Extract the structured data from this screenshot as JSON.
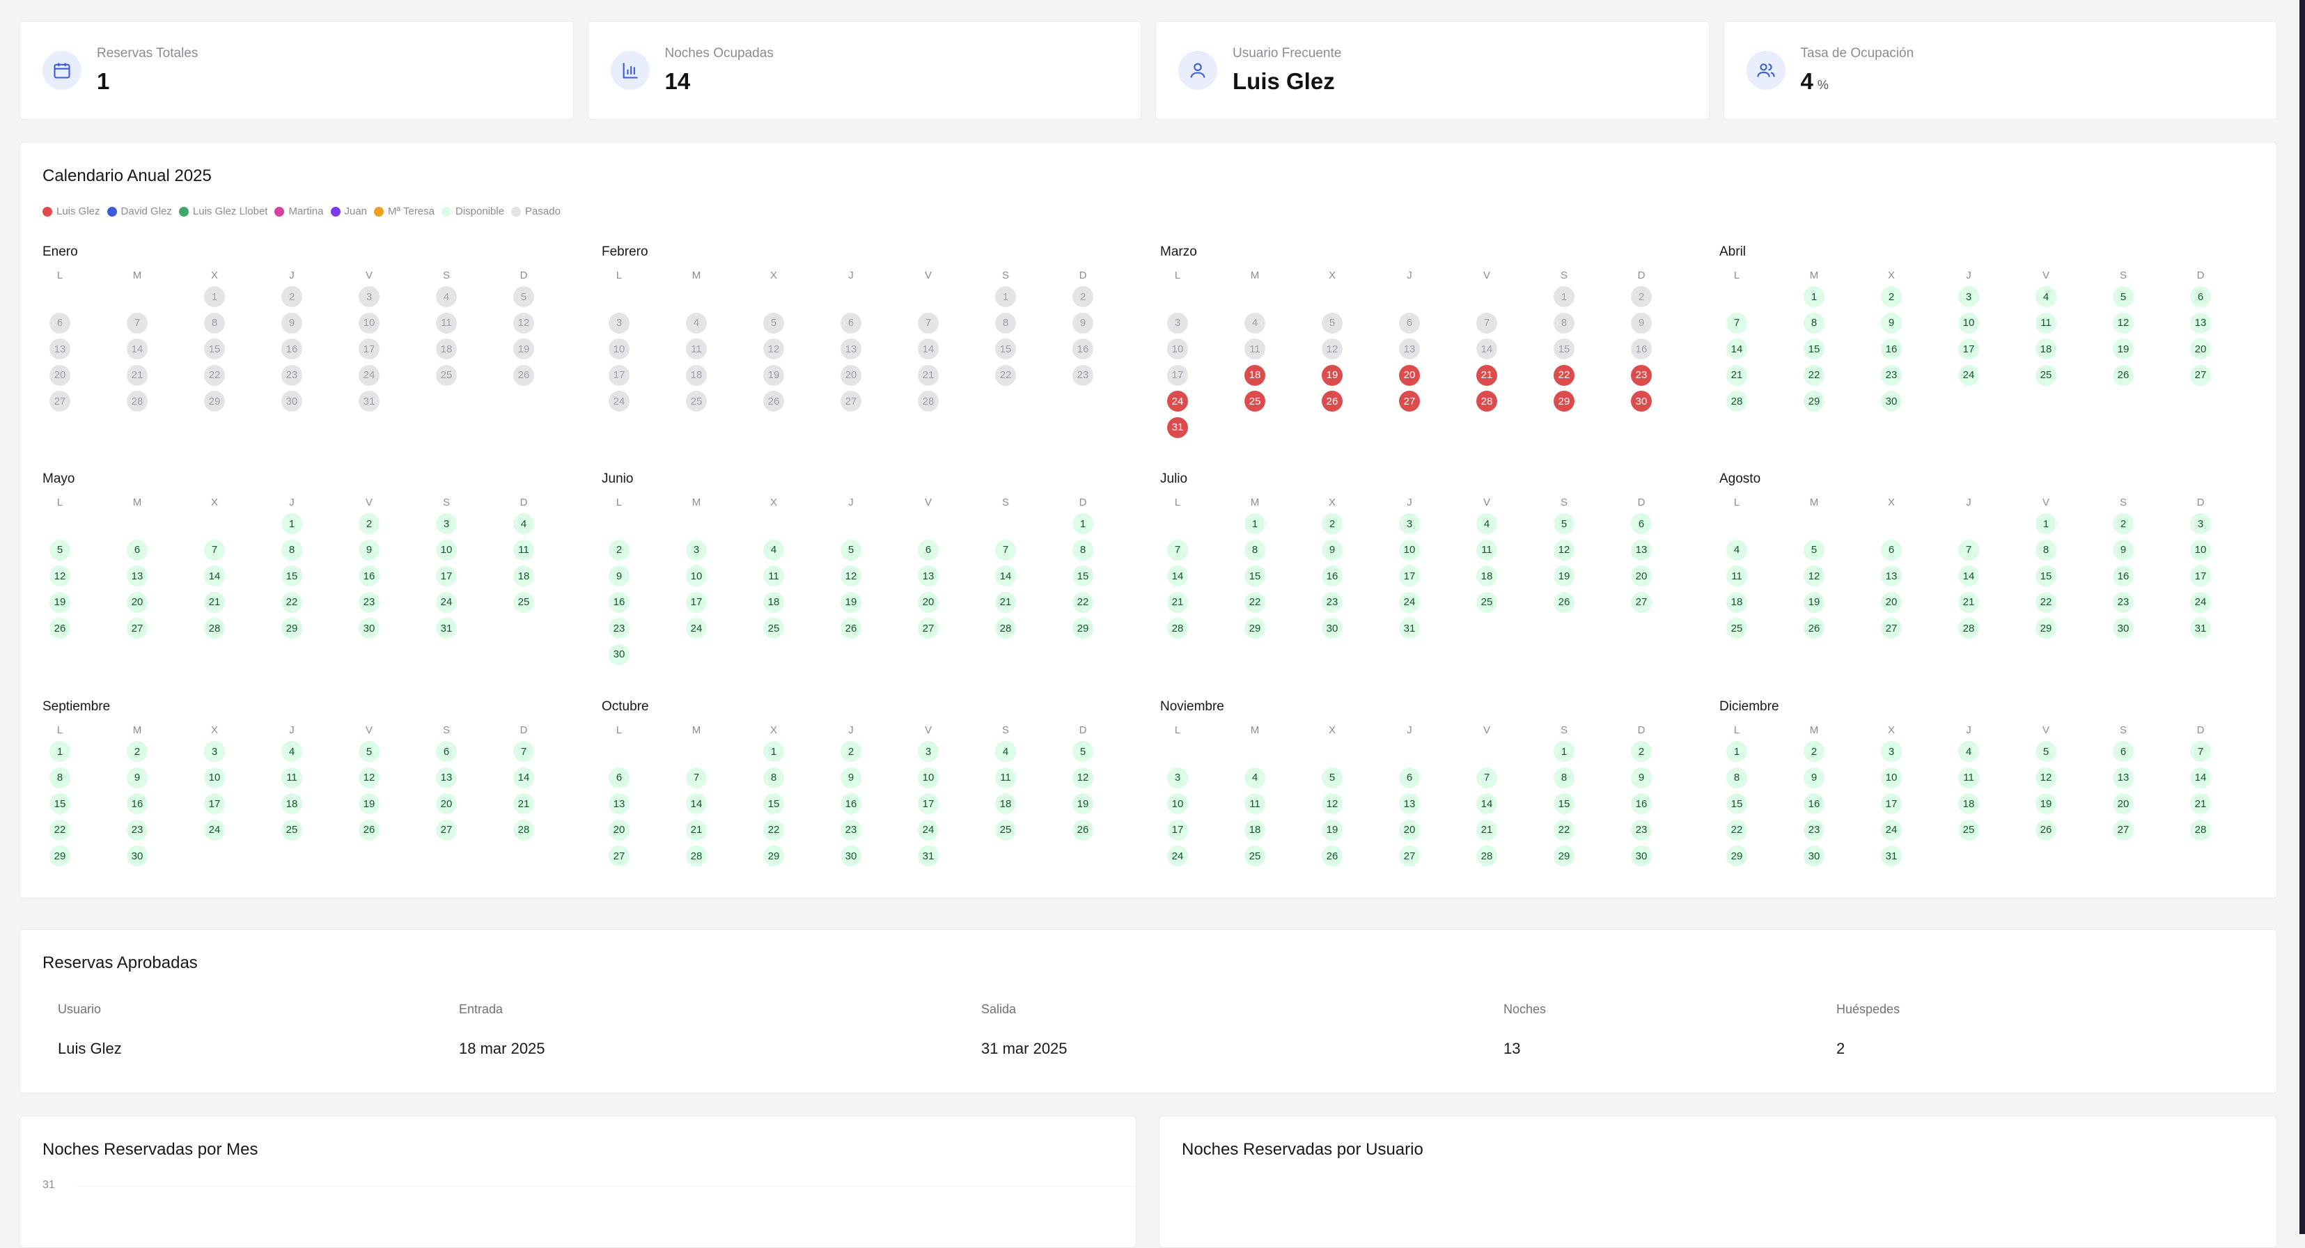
{
  "stats": [
    {
      "label": "Reservas Totales",
      "value": "1",
      "unit": "",
      "icon": "calendar-icon"
    },
    {
      "label": "Noches Ocupadas",
      "value": "14",
      "unit": "",
      "icon": "bar-chart-icon"
    },
    {
      "label": "Usuario Frecuente",
      "value": "Luis Glez",
      "unit": "",
      "icon": "user-icon"
    },
    {
      "label": "Tasa de Ocupación",
      "value": "4",
      "unit": "%",
      "icon": "users-icon"
    }
  ],
  "calendar": {
    "title": "Calendario Anual 2025",
    "legend": [
      {
        "label": "Luis Glez",
        "color": "#e5484d"
      },
      {
        "label": "David Glez",
        "color": "#3b5bdb"
      },
      {
        "label": "Luis Glez Llobet",
        "color": "#40a66a"
      },
      {
        "label": "Martina",
        "color": "#d6409f"
      },
      {
        "label": "Juan",
        "color": "#7c3aed"
      },
      {
        "label": "Mª Teresa",
        "color": "#f0a020"
      },
      {
        "label": "Disponible",
        "color": "#dcfce7"
      },
      {
        "label": "Pasado",
        "color": "#e4e4e7"
      }
    ],
    "weekdays": [
      "L",
      "M",
      "X",
      "J",
      "V",
      "S",
      "D"
    ],
    "past_through": {
      "month": 3,
      "day": 17
    },
    "booked": [
      {
        "month": 3,
        "from": 18,
        "to": 31,
        "color": "#dc4c4c"
      }
    ],
    "months": [
      {
        "name": "Enero",
        "first_weekday": 2,
        "days": 31
      },
      {
        "name": "Febrero",
        "first_weekday": 5,
        "days": 28
      },
      {
        "name": "Marzo",
        "first_weekday": 5,
        "days": 31
      },
      {
        "name": "Abril",
        "first_weekday": 1,
        "days": 30
      },
      {
        "name": "Mayo",
        "first_weekday": 3,
        "days": 31
      },
      {
        "name": "Junio",
        "first_weekday": 6,
        "days": 30
      },
      {
        "name": "Julio",
        "first_weekday": 1,
        "days": 31
      },
      {
        "name": "Agosto",
        "first_weekday": 4,
        "days": 31
      },
      {
        "name": "Septiembre",
        "first_weekday": 0,
        "days": 30
      },
      {
        "name": "Octubre",
        "first_weekday": 2,
        "days": 31
      },
      {
        "name": "Noviembre",
        "first_weekday": 5,
        "days": 30
      },
      {
        "name": "Diciembre",
        "first_weekday": 0,
        "days": 31
      }
    ]
  },
  "reservations": {
    "title": "Reservas Aprobadas",
    "headers": [
      "Usuario",
      "Entrada",
      "Salida",
      "Noches",
      "Huéspedes"
    ],
    "rows": [
      [
        "Luis Glez",
        "18 mar 2025",
        "31 mar 2025",
        "13",
        "2"
      ]
    ]
  },
  "charts": {
    "by_month_title": "Noches Reservadas por Mes",
    "by_month_ytick": "31",
    "by_user_title": "Noches Reservadas por Usuario"
  }
}
